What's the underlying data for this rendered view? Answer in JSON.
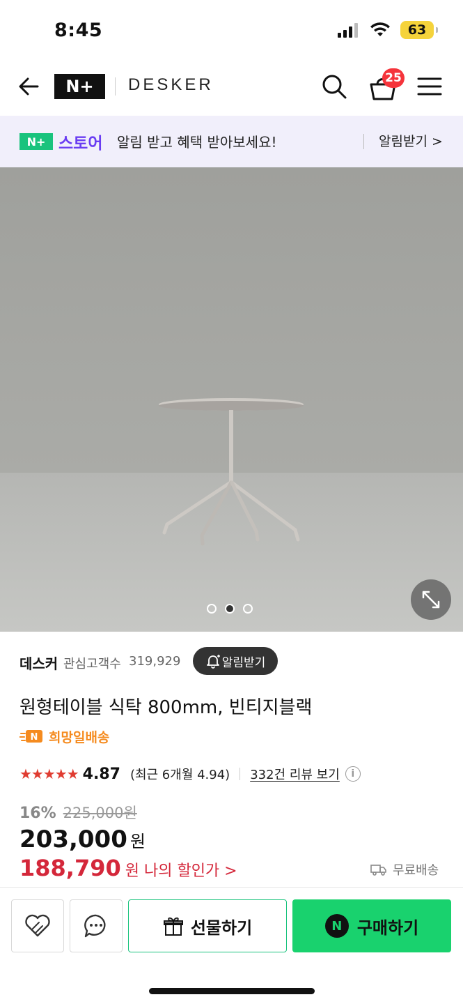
{
  "status_bar": {
    "time": "8:45",
    "battery": "63"
  },
  "header": {
    "logo": "N+",
    "brand": "DESKER",
    "cart_count": "25",
    "icons": [
      "back-arrow-icon",
      "search-icon",
      "cart-icon",
      "menu-icon"
    ]
  },
  "promo": {
    "logo": "N+",
    "store": "스토어",
    "text": "알림 받고 혜택 받아보세요!",
    "action": "알림받기 >"
  },
  "gallery": {
    "total": 3,
    "current": 2
  },
  "product": {
    "seller": "데스커",
    "followers_label": "관심고객수",
    "followers_count": "319,929",
    "notify_label": "알림받기",
    "title": "원형테이블 식탁 800mm, 빈티지블랙",
    "delivery_tag": "희망일배송",
    "rating": {
      "stars": "★★★★★",
      "score": "4.87",
      "recent": "(최근 6개월 4.94)",
      "review_link": "332건 리뷰 보기"
    },
    "discount_pct": "16%",
    "original_price": "225,000원",
    "price": "203,000",
    "price_unit": "원",
    "my_price": "188,790",
    "my_price_label": "원 나의 할인가 >",
    "shipping": "무료배송"
  },
  "bottom_bar": {
    "gift_label": "선물하기",
    "buy_label": "구매하기",
    "buy_logo": "N"
  },
  "colors": {
    "naver_green": "#19d26e",
    "store_purple": "#6a3df2",
    "sale_red": "#d4273a",
    "star_red": "#e03c31",
    "delivery_orange": "#f58b1f",
    "badge_red": "#f5343b"
  }
}
